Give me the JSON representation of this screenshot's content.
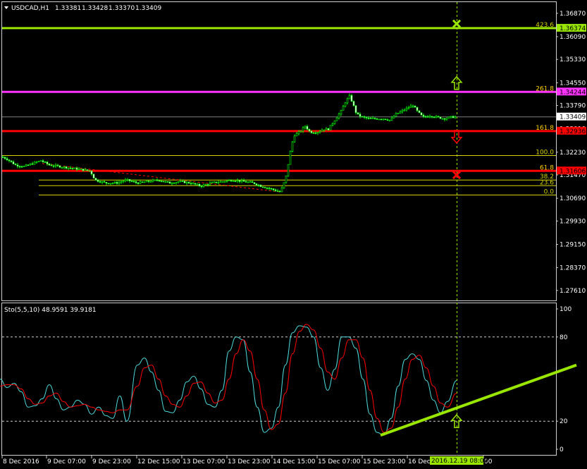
{
  "chart_data": [
    {
      "type": "candlestick",
      "title": "USDCAD,H1",
      "ohlc_header": [
        "1.33381",
        "1.33428",
        "1.33370",
        "1.33409"
      ],
      "ylim": [
        1.27276,
        1.37244
      ],
      "y_ticks": [
        "1.36870",
        "1.36090",
        "1.35330",
        "1.34550",
        "1.33790",
        "1.33010",
        "1.32230",
        "1.31470",
        "1.30690",
        "1.29930",
        "1.29150",
        "1.28370",
        "1.27610"
      ],
      "price_tags": [
        {
          "text": "1.36374",
          "bg": "#99e600",
          "fg": "#000000"
        },
        {
          "text": "1.34244",
          "bg": "#ff33ff",
          "fg": "#000000"
        },
        {
          "text": "1.33409",
          "bg": "#ffffff",
          "fg": "#000000"
        },
        {
          "text": "1.32936",
          "bg": "#ff0000",
          "fg": "#000000"
        },
        {
          "text": "1.31606",
          "bg": "#ff0000",
          "fg": "#000000"
        }
      ],
      "fib_levels": [
        {
          "label": "423.6",
          "price": 1.36374,
          "color": "#99e600"
        },
        {
          "label": "261.8",
          "price": 1.34244,
          "color": "#ff33ff"
        },
        {
          "label": "161.8",
          "price": 1.32936,
          "color": "#ff0000"
        },
        {
          "label": "100.0",
          "price": 1.3212,
          "color": "#d4d400"
        },
        {
          "label": "61.8",
          "price": 1.31606,
          "color": "#ff0000"
        },
        {
          "label": "38.2",
          "price": 1.313,
          "color": "#d4d400"
        },
        {
          "label": "23.6",
          "price": 1.3111,
          "color": "#d4d400"
        },
        {
          "label": "0.0",
          "price": 1.308,
          "color": "#d4d400"
        }
      ],
      "close_path": [
        [
          0,
          1.321
        ],
        [
          10,
          1.32
        ],
        [
          22,
          1.318
        ],
        [
          34,
          1.3175
        ],
        [
          46,
          1.3185
        ],
        [
          58,
          1.3195
        ],
        [
          70,
          1.318
        ],
        [
          85,
          1.3175
        ],
        [
          100,
          1.317
        ],
        [
          115,
          1.3165
        ],
        [
          128,
          1.316
        ],
        [
          135,
          1.313
        ],
        [
          150,
          1.312
        ],
        [
          165,
          1.312
        ],
        [
          180,
          1.313
        ],
        [
          195,
          1.312
        ],
        [
          210,
          1.3125
        ],
        [
          225,
          1.313
        ],
        [
          240,
          1.312
        ],
        [
          255,
          1.3125
        ],
        [
          270,
          1.312
        ],
        [
          285,
          1.311
        ],
        [
          300,
          1.312
        ],
        [
          315,
          1.3125
        ],
        [
          330,
          1.313
        ],
        [
          345,
          1.3125
        ],
        [
          360,
          1.312
        ],
        [
          370,
          1.311
        ],
        [
          385,
          1.31
        ],
        [
          398,
          1.309
        ],
        [
          403,
          1.312
        ],
        [
          407,
          1.315
        ],
        [
          410,
          1.32
        ],
        [
          414,
          1.325
        ],
        [
          418,
          1.328
        ],
        [
          425,
          1.329
        ],
        [
          433,
          1.331
        ],
        [
          440,
          1.329
        ],
        [
          450,
          1.329
        ],
        [
          460,
          1.33
        ],
        [
          466,
          1.33
        ],
        [
          472,
          1.332
        ],
        [
          478,
          1.334
        ],
        [
          484,
          1.336
        ],
        [
          490,
          1.339
        ],
        [
          496,
          1.341
        ],
        [
          500,
          1.339
        ],
        [
          506,
          1.335
        ],
        [
          514,
          1.334
        ],
        [
          524,
          1.3335
        ],
        [
          534,
          1.3335
        ],
        [
          544,
          1.3335
        ],
        [
          554,
          1.333
        ],
        [
          562,
          1.335
        ],
        [
          570,
          1.336
        ],
        [
          578,
          1.337
        ],
        [
          586,
          1.338
        ],
        [
          592,
          1.336
        ],
        [
          600,
          1.334
        ],
        [
          610,
          1.3345
        ],
        [
          620,
          1.334
        ],
        [
          630,
          1.3335
        ],
        [
          640,
          1.334
        ],
        [
          648,
          1.3341
        ]
      ],
      "x_ticks": [
        "8 Dec 2016",
        "9 Dec 07:00",
        "9 Dec 23:00",
        "12 Dec 15:00",
        "13 Dec 07:00",
        "13 Dec 23:00",
        "14 Dec 15:00",
        "15 Dec 07:00",
        "15 Dec 23:00",
        "16 Dec",
        "00"
      ],
      "crosshair_label": "2016.12.19 08:00",
      "signals": [
        {
          "kind": "x-mark",
          "price": 1.3652,
          "color": "#99e600"
        },
        {
          "kind": "up-arrow",
          "price": 1.3454,
          "color": "#99e600"
        },
        {
          "kind": "down-arrow",
          "price": 1.3275,
          "color": "#ff0000"
        },
        {
          "kind": "x-mark",
          "price": 1.3147,
          "color": "#ff0000"
        }
      ]
    },
    {
      "type": "line",
      "title": "Sto(5,5,10) 48.9591 39.9181",
      "ylim": [
        0,
        100
      ],
      "y_ticks": [
        "100",
        "80",
        "20",
        "0"
      ],
      "levels": [
        80,
        20
      ],
      "series": [
        {
          "color": "#4dd9d9",
          "points": [
            [
              0,
              50
            ],
            [
              10,
              44
            ],
            [
              20,
              47
            ],
            [
              30,
              41
            ],
            [
              40,
              30
            ],
            [
              50,
              31
            ],
            [
              60,
              36
            ],
            [
              70,
              46
            ],
            [
              80,
              36
            ],
            [
              90,
              28
            ],
            [
              100,
              30
            ],
            [
              110,
              35
            ],
            [
              120,
              32
            ],
            [
              130,
              25
            ],
            [
              140,
              30
            ],
            [
              150,
              24
            ],
            [
              160,
              22
            ],
            [
              170,
              38
            ],
            [
              180,
              20
            ],
            [
              195,
              60
            ],
            [
              205,
              65
            ],
            [
              215,
              55
            ],
            [
              225,
              42
            ],
            [
              235,
              27
            ],
            [
              245,
              26
            ],
            [
              255,
              35
            ],
            [
              265,
              48
            ],
            [
              275,
              52
            ],
            [
              285,
              43
            ],
            [
              295,
              32
            ],
            [
              305,
              30
            ],
            [
              315,
              42
            ],
            [
              325,
              70
            ],
            [
              335,
              80
            ],
            [
              345,
              78
            ],
            [
              355,
              55
            ],
            [
              365,
              30
            ],
            [
              375,
              12
            ],
            [
              385,
              15
            ],
            [
              395,
              30
            ],
            [
              405,
              60
            ],
            [
              415,
              83
            ],
            [
              425,
              88
            ],
            [
              435,
              87
            ],
            [
              445,
              80
            ],
            [
              455,
              58
            ],
            [
              465,
              42
            ],
            [
              475,
              57
            ],
            [
              485,
              80
            ],
            [
              495,
              80
            ],
            [
              505,
              72
            ],
            [
              515,
              50
            ],
            [
              525,
              25
            ],
            [
              535,
              12
            ],
            [
              545,
              10
            ],
            [
              555,
              22
            ],
            [
              565,
              45
            ],
            [
              575,
              64
            ],
            [
              585,
              68
            ],
            [
              595,
              64
            ],
            [
              605,
              49
            ],
            [
              615,
              35
            ],
            [
              625,
              26
            ],
            [
              635,
              34
            ],
            [
              648,
              48.96
            ]
          ]
        },
        {
          "color": "#ff0000",
          "points": [
            [
              0,
              45
            ],
            [
              10,
              46
            ],
            [
              20,
              46
            ],
            [
              30,
              43
            ],
            [
              40,
              36
            ],
            [
              50,
              32
            ],
            [
              60,
              33
            ],
            [
              70,
              38
            ],
            [
              80,
              40
            ],
            [
              90,
              34
            ],
            [
              100,
              30
            ],
            [
              110,
              31
            ],
            [
              120,
              32
            ],
            [
              130,
              30
            ],
            [
              140,
              28
            ],
            [
              150,
              27
            ],
            [
              160,
              26
            ],
            [
              170,
              28
            ],
            [
              180,
              28
            ],
            [
              195,
              45
            ],
            [
              205,
              58
            ],
            [
              215,
              60
            ],
            [
              225,
              50
            ],
            [
              235,
              38
            ],
            [
              245,
              32
            ],
            [
              255,
              30
            ],
            [
              265,
              38
            ],
            [
              275,
              47
            ],
            [
              285,
              48
            ],
            [
              295,
              40
            ],
            [
              305,
              33
            ],
            [
              315,
              35
            ],
            [
              325,
              50
            ],
            [
              335,
              68
            ],
            [
              345,
              78
            ],
            [
              355,
              70
            ],
            [
              365,
              50
            ],
            [
              375,
              28
            ],
            [
              385,
              14
            ],
            [
              395,
              18
            ],
            [
              405,
              40
            ],
            [
              415,
              68
            ],
            [
              425,
              84
            ],
            [
              435,
              89
            ],
            [
              445,
              85
            ],
            [
              455,
              72
            ],
            [
              465,
              55
            ],
            [
              475,
              50
            ],
            [
              485,
              65
            ],
            [
              495,
              78
            ],
            [
              505,
              78
            ],
            [
              515,
              65
            ],
            [
              525,
              42
            ],
            [
              535,
              22
            ],
            [
              545,
              12
            ],
            [
              555,
              15
            ],
            [
              565,
              30
            ],
            [
              575,
              50
            ],
            [
              585,
              64
            ],
            [
              595,
              67
            ],
            [
              605,
              58
            ],
            [
              615,
              45
            ],
            [
              625,
              33
            ],
            [
              635,
              30
            ],
            [
              648,
              39.92
            ]
          ]
        }
      ],
      "trendline": {
        "color": "#99e600",
        "from": [
          540,
          10
        ],
        "to": [
          818,
          60
        ]
      },
      "signals": [
        {
          "kind": "up-arrow",
          "value": 20,
          "color": "#99e600"
        }
      ]
    }
  ]
}
